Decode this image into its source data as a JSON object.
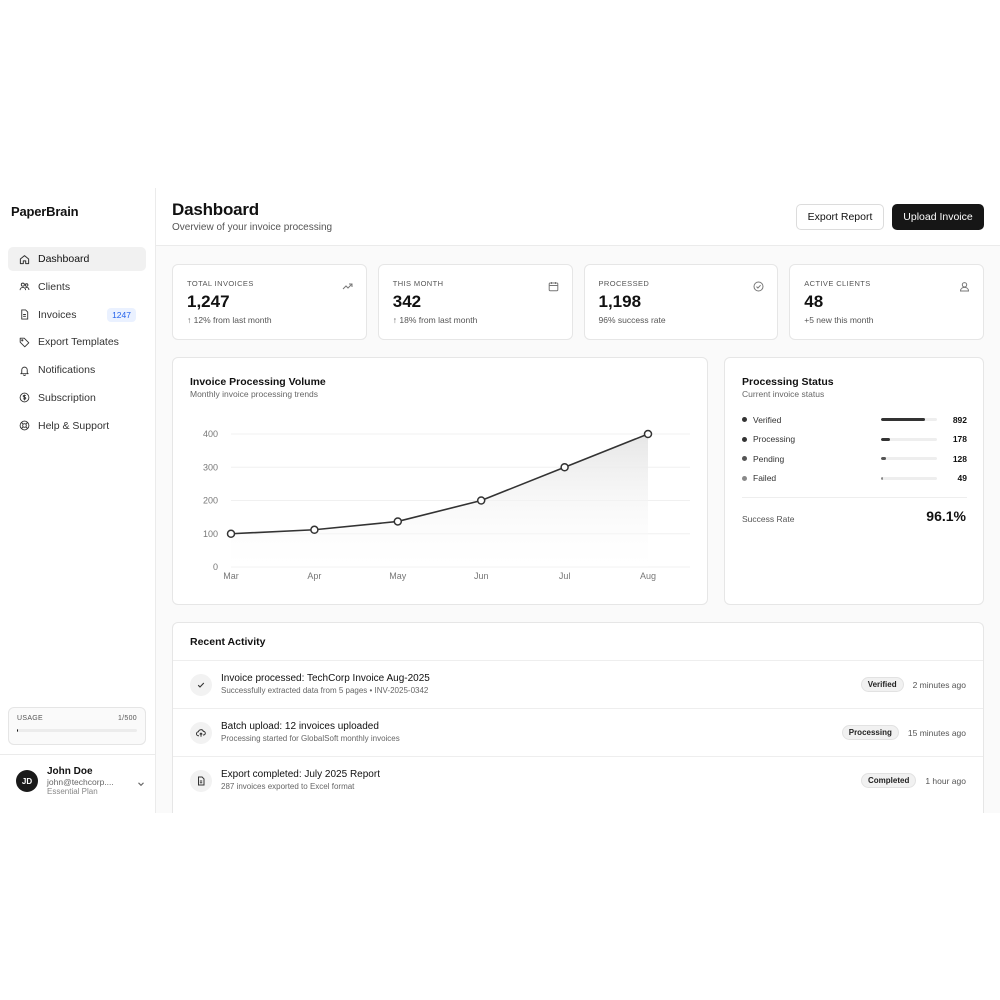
{
  "brand": "PaperBrain",
  "sidebar": {
    "items": [
      {
        "label": "Dashboard",
        "icon": "home-icon",
        "active": true
      },
      {
        "label": "Clients",
        "icon": "users-icon"
      },
      {
        "label": "Invoices",
        "icon": "file-icon",
        "badge": "1247"
      },
      {
        "label": "Export Templates",
        "icon": "tag-icon"
      },
      {
        "label": "Notifications",
        "icon": "bell-icon"
      },
      {
        "label": "Subscription",
        "icon": "dollar-icon"
      },
      {
        "label": "Help & Support",
        "icon": "lifebuoy-icon"
      }
    ],
    "usage": {
      "label": "USAGE",
      "count": "1/500",
      "fraction": 0.002
    },
    "user": {
      "initials": "JD",
      "name": "John Doe",
      "email": "john@techcorp....",
      "plan": "Essential Plan"
    }
  },
  "header": {
    "title": "Dashboard",
    "subtitle": "Overview of your invoice processing",
    "export_label": "Export Report",
    "upload_label": "Upload Invoice"
  },
  "stats": [
    {
      "label": "TOTAL INVOICES",
      "value": "1,247",
      "sub": "↑ 12% from last month",
      "icon": "trend-up-icon"
    },
    {
      "label": "THIS MONTH",
      "value": "342",
      "sub": "↑ 18% from last month",
      "icon": "calendar-icon"
    },
    {
      "label": "PROCESSED",
      "value": "1,198",
      "sub": "96% success rate",
      "icon": "check-circle-icon"
    },
    {
      "label": "ACTIVE CLIENTS",
      "value": "48",
      "sub": "+5 new this month",
      "icon": "user-icon"
    }
  ],
  "chart_card": {
    "title": "Invoice Processing Volume",
    "subtitle": "Monthly invoice processing trends"
  },
  "chart_data": {
    "type": "area",
    "categories": [
      "Mar",
      "Apr",
      "May",
      "Jun",
      "Jul",
      "Aug"
    ],
    "series": [
      {
        "values": [
          100,
          112,
          137,
          200,
          300,
          400
        ]
      }
    ],
    "ylim": [
      0,
      400
    ],
    "yticks": [
      0,
      100,
      200,
      300,
      400
    ],
    "grid": true,
    "colors": {
      "line": "#333333",
      "fill": "#e6e6e6"
    }
  },
  "status_card": {
    "title": "Processing Status",
    "subtitle": "Current invoice status",
    "items": [
      {
        "label": "Verified",
        "value": "892",
        "fraction": 0.78,
        "color": "#333333"
      },
      {
        "label": "Processing",
        "value": "178",
        "fraction": 0.16,
        "color": "#333333"
      },
      {
        "label": "Pending",
        "value": "128",
        "fraction": 0.09,
        "color": "#555555"
      },
      {
        "label": "Failed",
        "value": "49",
        "fraction": 0.03,
        "color": "#8a8a8a"
      }
    ],
    "success_label": "Success Rate",
    "success_value": "96.1%"
  },
  "activity": {
    "title": "Recent Activity",
    "items": [
      {
        "icon": "check-icon",
        "title": "Invoice processed: TechCorp Invoice Aug-2025",
        "desc": "Successfully extracted data from 5 pages • INV-2025-0342",
        "badge": "Verified",
        "time": "2 minutes ago"
      },
      {
        "icon": "upload-cloud-icon",
        "title": "Batch upload: 12 invoices uploaded",
        "desc": "Processing started for GlobalSoft monthly invoices",
        "badge": "Processing",
        "time": "15 minutes ago"
      },
      {
        "icon": "document-icon",
        "title": "Export completed: July 2025 Report",
        "desc": "287 invoices exported to Excel format",
        "badge": "Completed",
        "time": "1 hour ago"
      }
    ]
  }
}
